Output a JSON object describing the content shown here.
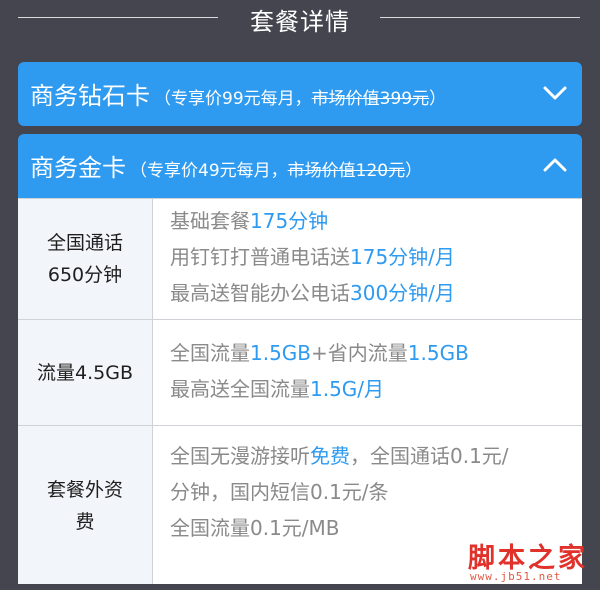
{
  "header": {
    "title": "套餐详情"
  },
  "cards": [
    {
      "name": "商务钻石卡",
      "promo_prefix": "（专享价99元每月，",
      "promo_strike": "市场价值399元",
      "promo_suffix": "）",
      "chevron": "chevron-down-icon"
    },
    {
      "name": "商务金卡",
      "promo_prefix": "（专享价49元每月，",
      "promo_strike": "市场价值120元",
      "promo_suffix": "）",
      "chevron": "chevron-up-icon"
    }
  ],
  "table": {
    "rows": [
      {
        "label_line1": "全国通话",
        "label_line2": "650分钟",
        "lines": [
          {
            "a": "基础套餐",
            "b": "175分钟",
            "c": ""
          },
          {
            "a": "用钉钉打普通电话送",
            "b": "175分钟/月",
            "c": ""
          },
          {
            "a": "最高送智能办公电话",
            "b": "300分钟/月",
            "c": ""
          }
        ]
      },
      {
        "label_line1": "流量4.5GB",
        "lines": [
          {
            "a": "全国流量",
            "b": "1.5GB",
            "c": "+省内流量",
            "d": "1.5GB"
          },
          {
            "a": "最高送全国流量",
            "b": "1.5G/月"
          }
        ]
      },
      {
        "label_line1": "套餐外资",
        "label_line2": "费",
        "lines": [
          {
            "a": "全国无漫游接听",
            "b": "免费",
            "c": "，全国通话0.1元/"
          },
          {
            "a": "分钟，国内短信0.1元/条"
          },
          {
            "a": "全国流量0.1元/MB"
          }
        ]
      }
    ]
  },
  "watermark": {
    "text": "脚本之家",
    "url": "www.jb51.net"
  },
  "colors": {
    "accent": "#2e9af0",
    "background": "#45454f",
    "muted": "#8a8a8a"
  }
}
